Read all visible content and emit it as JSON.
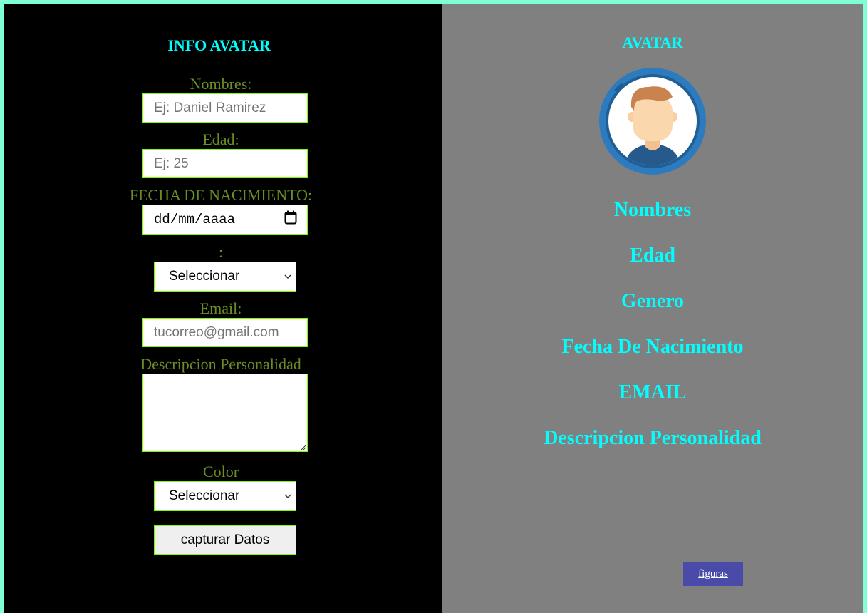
{
  "form": {
    "title": "INFO AVATAR",
    "nombres_label": "Nombres:",
    "nombres_placeholder": "Ej: Daniel Ramirez",
    "edad_label": "Edad:",
    "edad_placeholder": "Ej: 25",
    "fecha_label": "FECHA DE NACIMIENTO:",
    "fecha_placeholder": "dd/mm/aaaa",
    "genero_label": ":",
    "genero_selected": "Seleccionar",
    "email_label": "Email:",
    "email_placeholder": "tucorreo@gmail.com",
    "descripcion_label": "Descripcion Personalidad",
    "descripcion_value": "",
    "color_label": "Color",
    "color_selected": "Seleccionar",
    "submit_label": "capturar Datos"
  },
  "preview": {
    "title": "AVATAR",
    "fields": [
      "Nombres",
      "Edad",
      "Genero",
      "Fecha De Nacimiento",
      "EMAIL",
      "Descripcion Personalidad"
    ],
    "link_label": "figuras"
  },
  "icons": {
    "avatar": "avatar-icon",
    "calendar": "calendar-icon",
    "select_arrow": "chevron-down-icon"
  },
  "colors": {
    "border": "#7fffd4",
    "left_panel": "#000000",
    "right_panel": "#808080",
    "title": "#00ffff",
    "label": "#6b8e23",
    "input_border": "#7cfc00",
    "link_button": "#4a4aa8"
  }
}
